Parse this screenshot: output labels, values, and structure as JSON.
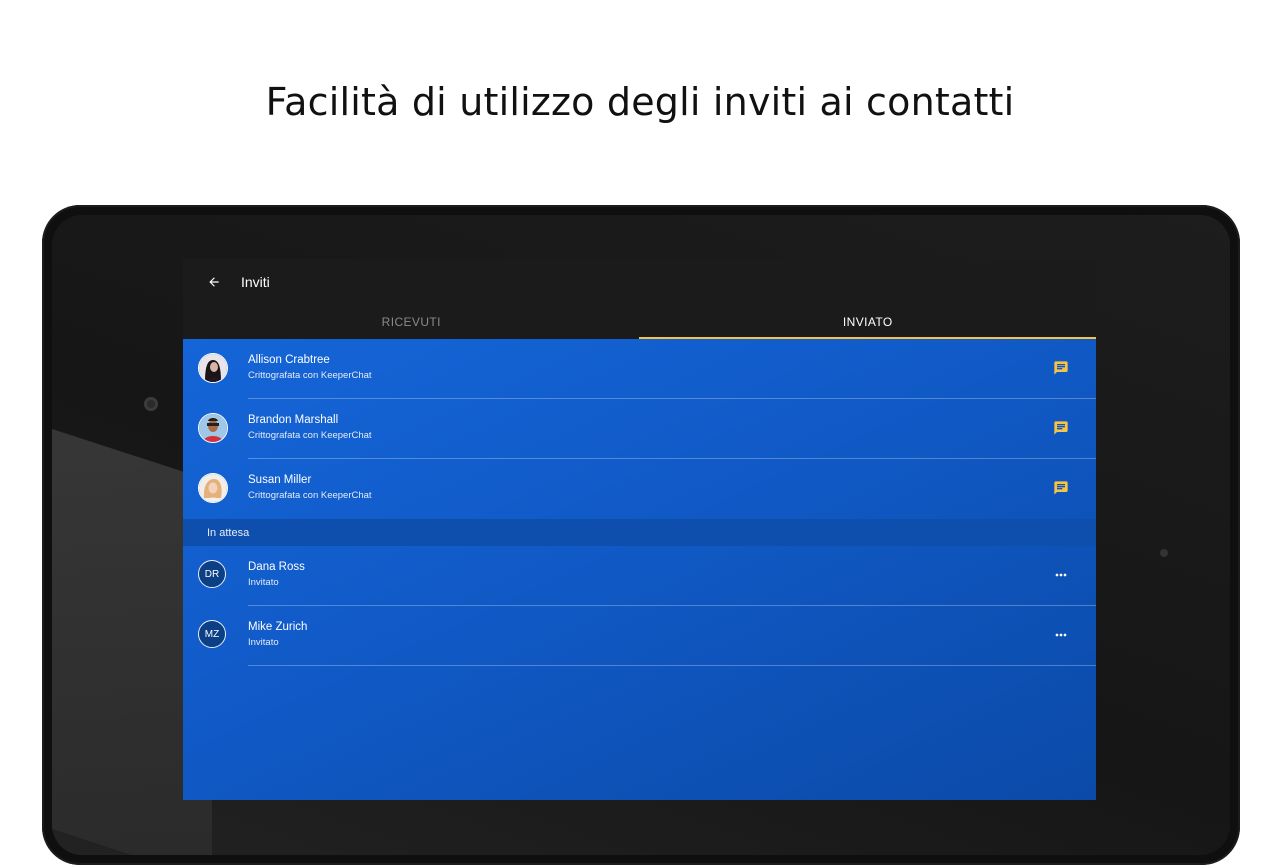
{
  "headline": "Facilità di utilizzo degli inviti ai contatti",
  "appbar": {
    "back_icon": "arrow-left-icon",
    "title": "Inviti"
  },
  "tabs": [
    {
      "label": "RICEVUTI",
      "selected": false
    },
    {
      "label": "INVIATO",
      "selected": true
    }
  ],
  "accepted": [
    {
      "name": "Allison Crabtree",
      "subtitle": "Crittografata con KeeperChat",
      "action_icon": "chat-icon"
    },
    {
      "name": "Brandon Marshall",
      "subtitle": "Crittografata con KeeperChat",
      "action_icon": "chat-icon"
    },
    {
      "name": "Susan Miller",
      "subtitle": "Crittografata con KeeperChat",
      "action_icon": "chat-icon"
    }
  ],
  "pending": {
    "header": "In attesa",
    "items": [
      {
        "initials": "DR",
        "name": "Dana Ross",
        "subtitle": "Invitato",
        "action_icon": "more-horizontal-icon"
      },
      {
        "initials": "MZ",
        "name": "Mike Zurich",
        "subtitle": "Invitato",
        "action_icon": "more-horizontal-icon"
      }
    ]
  },
  "colors": {
    "accent": "#f6c343",
    "list_background": "#1565d8",
    "appbar_background": "#1b1b1b"
  }
}
